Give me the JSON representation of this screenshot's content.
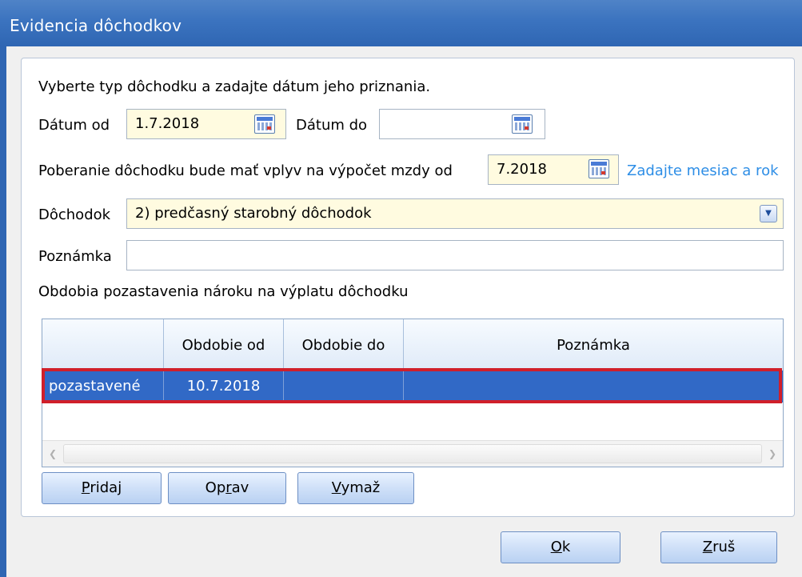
{
  "window": {
    "title": "Evidencia dôchodkov"
  },
  "form": {
    "instruction": "Vyberte typ dôchodku a zadajte dátum jeho priznania.",
    "date_from_label": "Dátum od",
    "date_from_value": "1.7.2018",
    "date_to_label": "Dátum do",
    "date_to_value": "",
    "payroll_effect_label": "Poberanie dôchodku bude mať vplyv na výpočet mzdy od",
    "payroll_effect_value": "7.2018",
    "payroll_effect_hint": "Zadajte mesiac a rok",
    "pension_label": "Dôchodok",
    "pension_value": "2) predčasný starobný dôchodok",
    "note_label": "Poznámka",
    "note_value": "",
    "suspension_section_label": "Obdobia pozastavenia nároku na výplatu dôchodku"
  },
  "grid": {
    "columns": [
      "",
      "Obdobie od",
      "Obdobie do",
      "Poznámka"
    ],
    "rows": [
      {
        "status": "pozastavené",
        "period_from": "10.7.2018",
        "period_to": "",
        "note": ""
      }
    ]
  },
  "grid_buttons": {
    "add": {
      "pre": "",
      "accel": "P",
      "post": "ridaj"
    },
    "edit": {
      "pre": "Op",
      "accel": "r",
      "post": "av"
    },
    "delete": {
      "pre": "",
      "accel": "V",
      "post": "ymaž"
    }
  },
  "dialog_buttons": {
    "ok": {
      "pre": "",
      "accel": "O",
      "post": "k"
    },
    "cancel": {
      "pre": "",
      "accel": "Z",
      "post": "ruš"
    }
  },
  "colors": {
    "titlebar": "#3b73bf",
    "selected_row": "#3169c6",
    "highlight_border": "#d01f2a",
    "link": "#2e8ee6",
    "input_yellow": "#fffbe0"
  }
}
